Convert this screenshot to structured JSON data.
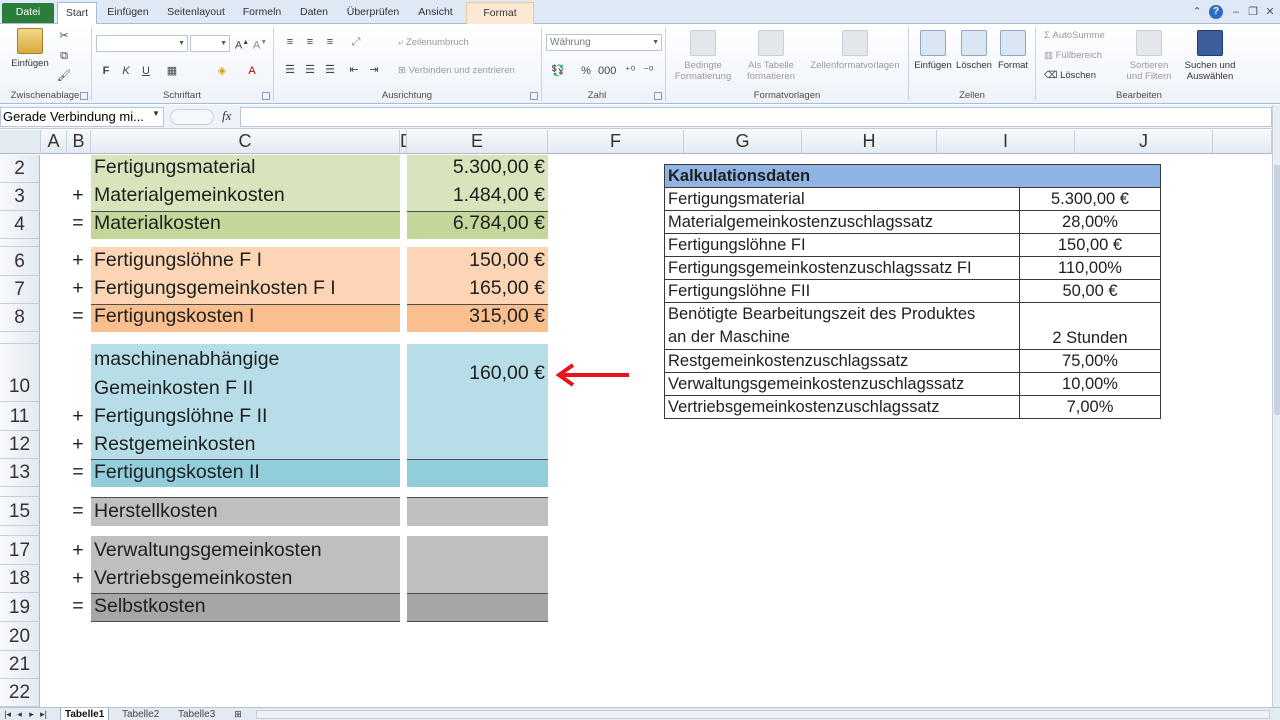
{
  "tabs": {
    "file": "Datei",
    "items": [
      "Start",
      "Einfügen",
      "Seitenlayout",
      "Formeln",
      "Daten",
      "Überprüfen",
      "Ansicht"
    ],
    "context": "Format"
  },
  "ribbon": {
    "clipboard": {
      "paste": "Einfügen",
      "label": "Zwischenablage"
    },
    "font": {
      "label": "Schriftart",
      "bold": "F",
      "italic": "K",
      "underline": "U"
    },
    "alignment": {
      "wrap": "Zeilenumbruch",
      "merge": "Verbinden und zentrieren",
      "label": "Ausrichtung"
    },
    "number": {
      "format_value": "Währung",
      "label": "Zahl"
    },
    "styles": {
      "conditional": [
        "Bedingte",
        "Formatierung"
      ],
      "as_table": [
        "Als Tabelle",
        "formatieren"
      ],
      "cell_styles": "Zellenformatvorlagen",
      "label": "Formatvorlagen"
    },
    "cells": {
      "insert": "Einfügen",
      "delete": "Löschen",
      "format": "Format",
      "label": "Zellen"
    },
    "editing": {
      "autosum": "AutoSumme",
      "fill": "Füllbereich",
      "clear": "Löschen",
      "sort": [
        "Sortieren",
        "und Filtern"
      ],
      "find": [
        "Suchen und",
        "Auswählen"
      ],
      "label": "Bearbeiten"
    }
  },
  "formula_bar": {
    "name_box": "Gerade Verbindung mi...",
    "fx": "fx",
    "formula": ""
  },
  "columns": [
    "A",
    "B",
    "C",
    "D",
    "E",
    "F",
    "G",
    "H",
    "I",
    "J"
  ],
  "rows": {
    "r2": "2",
    "r3": "3",
    "r4": "4",
    "r6": "6",
    "r7": "7",
    "r8": "8",
    "r10": "10",
    "r11": "11",
    "r12": "12",
    "r13": "13",
    "r15": "15",
    "r17": "17",
    "r18": "18",
    "r19": "19",
    "r20": "20",
    "r21": "21",
    "r22": "22"
  },
  "calc": {
    "material_title": "Fertigungsmaterial",
    "material_value": "5.300,00 €",
    "mgk_op": "+",
    "mgk_label": "Materialgemeinkosten",
    "mgk_value": "1.484,00 €",
    "mk_op": "=",
    "mk_label": "Materialkosten",
    "mk_value": "6.784,00 €",
    "fl1_op": "+",
    "fl1_label": "Fertigungslöhne F I",
    "fl1_value": "150,00 €",
    "fgk1_op": "+",
    "fgk1_label": "Fertigungsgemeinkosten F I",
    "fgk1_value": "165,00 €",
    "fk1_op": "=",
    "fk1_label": "Fertigungskosten I",
    "fk1_value": "315,00 €",
    "mag_label1": "maschinenabhängige",
    "mag_label2": "Gemeinkosten F II",
    "mag_value": "160,00 €",
    "fl2_op": "+",
    "fl2_label": "Fertigungslöhne F II",
    "rgk_op": "+",
    "rgk_label": "Restgemeinkosten",
    "fk2_op": "=",
    "fk2_label": "Fertigungskosten II",
    "hk_op": "=",
    "hk_label": "Herstellkosten",
    "vwgk_op": "+",
    "vwgk_label": "Verwaltungsgemeinkosten",
    "vtgk_op": "+",
    "vtgk_label": "Vertriebsgemeinkosten",
    "sk_op": "=",
    "sk_label": "Selbstkosten"
  },
  "kalkulationsdaten": {
    "title": "Kalkulationsdaten",
    "rows": [
      {
        "label": "Fertigungsmaterial",
        "value": "5.300,00 €"
      },
      {
        "label": "Materialgemeinkostenzuschlagssatz",
        "value": "28,00%"
      },
      {
        "label": "Fertigungslöhne FI",
        "value": "150,00 €"
      },
      {
        "label": "Fertigungsgemeinkostenzuschlagssatz FI",
        "value": "110,00%"
      },
      {
        "label": "Fertigungslöhne FII",
        "value": "50,00 €"
      },
      {
        "label1": "Benötigte Bearbeitungszeit des Produktes",
        "label2": "an der Maschine",
        "value": "2 Stunden"
      },
      {
        "label": "Restgemeinkostenzuschlagssatz",
        "value": "75,00%"
      },
      {
        "label": "Verwaltungsgemeinkostenzuschlagssatz",
        "value": "10,00%"
      },
      {
        "label": "Vertriebsgemeinkostenzuschlagssatz",
        "value": "7,00%"
      }
    ]
  },
  "sheets": [
    "Tabelle1",
    "Tabelle2",
    "Tabelle3"
  ],
  "colors": {
    "material": "#d8e4bc",
    "material_dark": "#c4d79b",
    "fertigung1": "#fcd5b4",
    "fertigung1_dark": "#fabf8f",
    "fertigung2": "#b7dee8",
    "fertigung2_dark": "#92cddc",
    "grey": "#bfbfbf",
    "grey_dark": "#a6a6a6",
    "arrow": "#e8141b",
    "table_header": "#8fb4e3"
  }
}
